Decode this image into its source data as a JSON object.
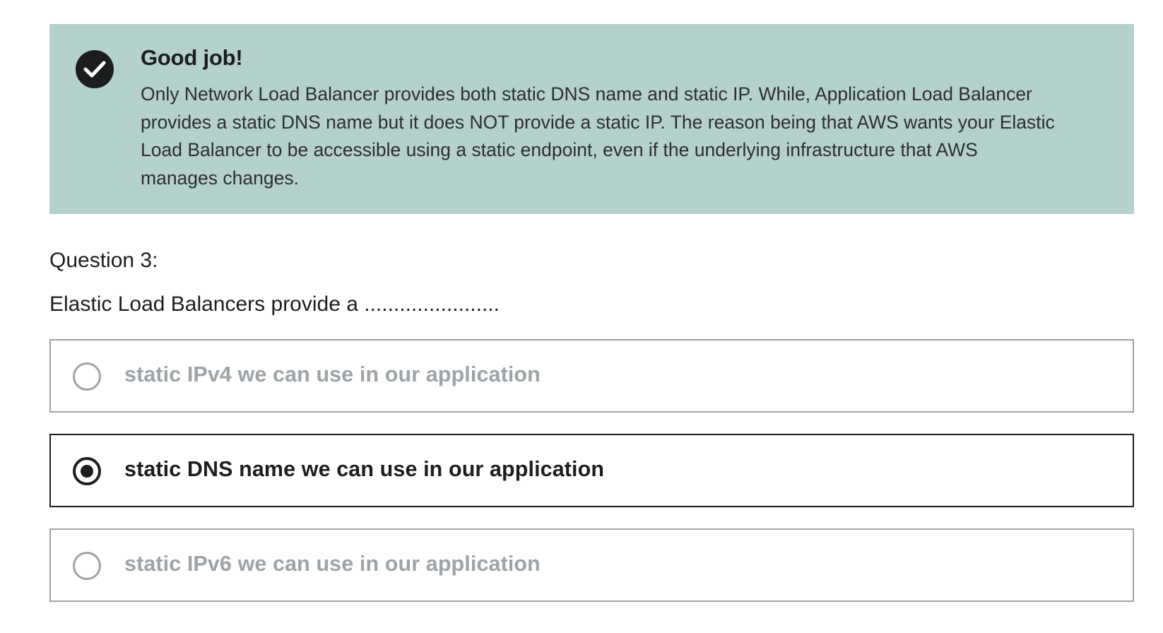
{
  "feedback": {
    "icon": "check-circle-icon",
    "title": "Good job!",
    "body_lines": [
      "Only Network Load Balancer provides both static DNS name and static IP. While, Application Load Balancer",
      "provides a static DNS name but it does NOT provide a static IP. The reason being that AWS wants your Elastic",
      "Load Balancer to be accessible using a static endpoint, even if the underlying infrastructure that AWS",
      "manages changes."
    ],
    "background_color": "#b4d1cc"
  },
  "question": {
    "number_label": "Question 3:",
    "text": "Elastic Load Balancers provide a ......................."
  },
  "options": [
    {
      "label": "static IPv4 we can use in our application",
      "selected": false
    },
    {
      "label": "static DNS name we can use in our application",
      "selected": true
    },
    {
      "label": "static IPv6 we can use in our application",
      "selected": false
    }
  ],
  "colors": {
    "text_dark": "#1c1d1f",
    "text_muted": "#9da3a7"
  }
}
